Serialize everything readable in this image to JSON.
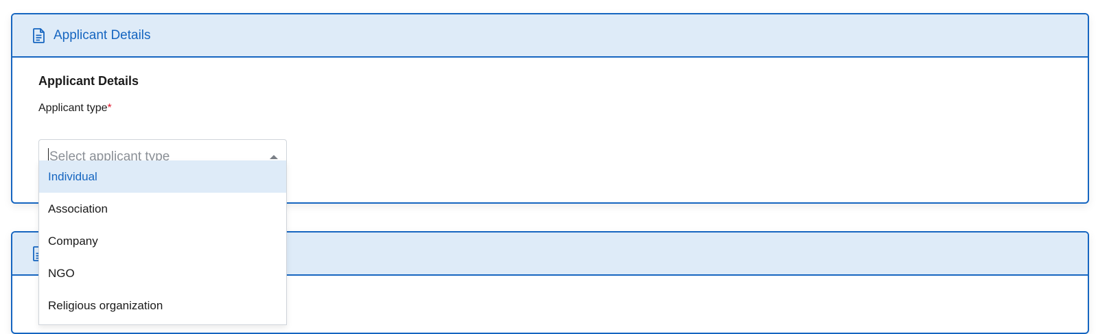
{
  "panels": [
    {
      "header_title": "Applicant Details",
      "icon": "document-icon"
    },
    {
      "header_title": "",
      "icon": "document-icon"
    }
  ],
  "applicant_section": {
    "heading": "Applicant Details",
    "field_label": "Applicant type",
    "required_marker": "*",
    "select": {
      "placeholder": "Select applicant type",
      "value": ""
    },
    "options": [
      {
        "label": "Individual",
        "highlighted": true
      },
      {
        "label": "Association",
        "highlighted": false
      },
      {
        "label": "Company",
        "highlighted": false
      },
      {
        "label": "NGO",
        "highlighted": false
      },
      {
        "label": "Religious organization",
        "highlighted": false
      }
    ]
  },
  "colors": {
    "accent": "#1565c0",
    "header_bg": "#deebf8",
    "required": "#e0162b"
  }
}
